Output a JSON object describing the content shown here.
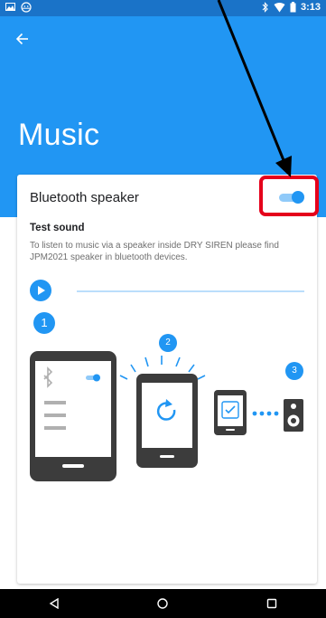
{
  "status_bar": {
    "time": "3:13",
    "left_icons": [
      "image-icon",
      "android-icon"
    ],
    "right_icons": [
      "bluetooth-icon",
      "wifi-icon",
      "battery-icon"
    ]
  },
  "header": {
    "title": "Music",
    "back_icon": "arrow-back-icon"
  },
  "card": {
    "bluetooth_speaker": {
      "label": "Bluetooth speaker",
      "enabled": true
    },
    "test_sound_title": "Test sound",
    "description": "To listen to music via a speaker inside DRY SIREN please find JPM2021 speaker in bluetooth devices.",
    "steps": [
      "1",
      "2",
      "3"
    ]
  },
  "nav_bar": {
    "buttons": [
      "back-icon",
      "home-icon",
      "recents-icon"
    ]
  },
  "colors": {
    "primary": "#2196f3",
    "status_bar": "#1a73c8",
    "highlight": "#e5001b",
    "device": "#3c3c3c"
  }
}
